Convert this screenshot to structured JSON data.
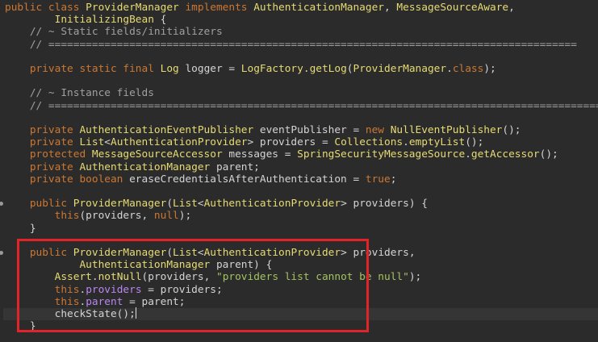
{
  "editor": {
    "theme_colors": {
      "background": "#2b2b2b",
      "keyword": "#cc7832",
      "type": "#e6db74",
      "comment": "#a0a0a0",
      "string": "#a5c261",
      "field": "#b987f0",
      "highlight_box": "#e2232a"
    },
    "lines": [
      [
        [
          "keyword",
          "public class "
        ],
        [
          "type",
          "ProviderManager"
        ],
        [
          "keyword",
          " implements "
        ],
        [
          "type",
          "AuthenticationManager"
        ],
        [
          "default",
          ", "
        ],
        [
          "type",
          "MessageSourceAware"
        ],
        [
          "default",
          ","
        ]
      ],
      [
        [
          "default",
          "        "
        ],
        [
          "type",
          "InitializingBean"
        ],
        [
          "default",
          " {"
        ]
      ],
      [
        [
          "comment",
          "    // ~ Static fields/initializers"
        ]
      ],
      [
        [
          "comment",
          "    // ====================================================================================="
        ]
      ],
      [],
      [
        [
          "keyword",
          "    private static final "
        ],
        [
          "type",
          "Log"
        ],
        [
          "default",
          " logger = "
        ],
        [
          "type",
          "LogFactory"
        ],
        [
          "default",
          "."
        ],
        [
          "method",
          "getLog"
        ],
        [
          "default",
          "("
        ],
        [
          "type",
          "ProviderManager"
        ],
        [
          "default",
          "."
        ],
        [
          "keyword",
          "class"
        ],
        [
          "default",
          ");"
        ]
      ],
      [],
      [
        [
          "comment",
          "    // ~ Instance fields"
        ]
      ],
      [
        [
          "comment",
          "    // ================================================================================================"
        ]
      ],
      [],
      [
        [
          "keyword",
          "    private "
        ],
        [
          "type",
          "AuthenticationEventPublisher"
        ],
        [
          "default",
          " eventPublisher = "
        ],
        [
          "keyword",
          "new "
        ],
        [
          "type",
          "NullEventPublisher"
        ],
        [
          "default",
          "();"
        ]
      ],
      [
        [
          "keyword",
          "    private "
        ],
        [
          "type",
          "List"
        ],
        [
          "default",
          "<"
        ],
        [
          "type",
          "AuthenticationProvider"
        ],
        [
          "default",
          "> providers = "
        ],
        [
          "type",
          "Collections"
        ],
        [
          "default",
          "."
        ],
        [
          "method",
          "emptyList"
        ],
        [
          "default",
          "();"
        ]
      ],
      [
        [
          "keyword",
          "    protected "
        ],
        [
          "type",
          "MessageSourceAccessor"
        ],
        [
          "default",
          " messages = "
        ],
        [
          "type",
          "SpringSecurityMessageSource"
        ],
        [
          "default",
          "."
        ],
        [
          "method",
          "getAccessor"
        ],
        [
          "default",
          "();"
        ]
      ],
      [
        [
          "keyword",
          "    private "
        ],
        [
          "type",
          "AuthenticationManager"
        ],
        [
          "default",
          " parent;"
        ]
      ],
      [
        [
          "keyword",
          "    private boolean "
        ],
        [
          "default",
          "eraseCredentialsAfterAuthentication = "
        ],
        [
          "keyword",
          "true"
        ],
        [
          "default",
          ";"
        ]
      ],
      [],
      [
        [
          "keyword",
          "    public "
        ],
        [
          "method",
          "ProviderManager"
        ],
        [
          "default",
          "("
        ],
        [
          "type",
          "List"
        ],
        [
          "default",
          "<"
        ],
        [
          "type",
          "AuthenticationProvider"
        ],
        [
          "default",
          "> providers) {"
        ]
      ],
      [
        [
          "default",
          "        "
        ],
        [
          "keyword",
          "this"
        ],
        [
          "default",
          "(providers, "
        ],
        [
          "keyword",
          "null"
        ],
        [
          "default",
          ");"
        ]
      ],
      [
        [
          "default",
          "    }"
        ]
      ],
      [],
      [
        [
          "keyword",
          "    public "
        ],
        [
          "method",
          "ProviderManager"
        ],
        [
          "default",
          "("
        ],
        [
          "type",
          "List"
        ],
        [
          "default",
          "<"
        ],
        [
          "type",
          "AuthenticationProvider"
        ],
        [
          "default",
          "> providers,"
        ]
      ],
      [
        [
          "default",
          "            "
        ],
        [
          "type",
          "AuthenticationManager"
        ],
        [
          "default",
          " parent) {"
        ]
      ],
      [
        [
          "default",
          "        "
        ],
        [
          "type",
          "Assert"
        ],
        [
          "default",
          "."
        ],
        [
          "method",
          "notNull"
        ],
        [
          "default",
          "(providers, "
        ],
        [
          "string",
          "\"providers list cannot be null\""
        ],
        [
          "default",
          ");"
        ]
      ],
      [
        [
          "default",
          "        "
        ],
        [
          "keyword",
          "this"
        ],
        [
          "default",
          "."
        ],
        [
          "field",
          "providers"
        ],
        [
          "default",
          " = providers;"
        ]
      ],
      [
        [
          "default",
          "        "
        ],
        [
          "keyword",
          "this"
        ],
        [
          "default",
          "."
        ],
        [
          "field",
          "parent"
        ],
        [
          "default",
          " = parent;"
        ]
      ],
      [
        [
          "default",
          "        checkState();"
        ]
      ],
      [
        [
          "default",
          "    }"
        ]
      ]
    ],
    "caret_line": 25,
    "fold_marker_lines": [
      16,
      20
    ]
  }
}
